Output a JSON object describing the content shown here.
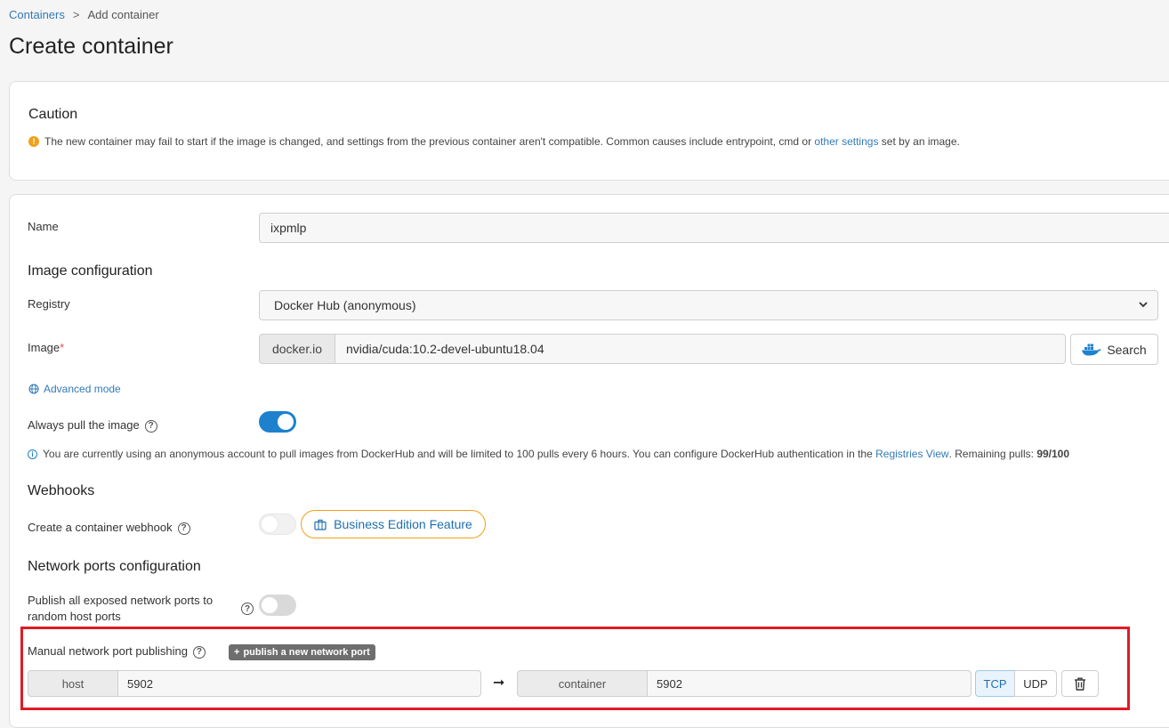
{
  "breadcrumb": {
    "root": "Containers",
    "separator": ">",
    "current": "Add container"
  },
  "page_title": "Create container",
  "caution": {
    "title": "Caution",
    "text_before": "The new container may fail to start if the image is changed, and settings from the previous container aren't compatible. Common causes include entrypoint, cmd or",
    "link": "other settings",
    "text_after": "set by an image."
  },
  "form": {
    "name_label": "Name",
    "name_value": "ixpmlp",
    "image_config_title": "Image configuration",
    "registry_label": "Registry",
    "registry_value": "Docker Hub (anonymous)",
    "image_label": "Image",
    "required_mark": "*",
    "image_prefix": "docker.io",
    "image_value": "nvidia/cuda:10.2-devel-ubuntu18.04",
    "search_button": "Search",
    "advanced_mode": "Advanced mode",
    "always_pull_label": "Always pull the image",
    "always_pull_on": true,
    "info_text": "You are currently using an anonymous account to pull images from DockerHub and will be limited to 100 pulls every 6 hours. You can configure DockerHub authentication in the",
    "info_link": "Registries View",
    "info_remaining": ". Remaining pulls:",
    "info_count": "99/100",
    "webhooks_title": "Webhooks",
    "webhook_label": "Create a container webhook",
    "business_badge": "Business Edition Feature",
    "network_title": "Network ports configuration",
    "publish_all_label": "Publish all exposed network ports to random host ports",
    "publish_all_on": false,
    "manual_label": "Manual network port publishing",
    "publish_new_button": "publish a new network port",
    "port": {
      "host_label": "host",
      "host_value": "5902",
      "container_label": "container",
      "container_value": "5902",
      "tcp": "TCP",
      "udp": "UDP",
      "active_protocol": "TCP"
    }
  },
  "colors": {
    "accent": "#1e81ce",
    "warning": "#f0a019",
    "highlight": "#e01b24"
  }
}
